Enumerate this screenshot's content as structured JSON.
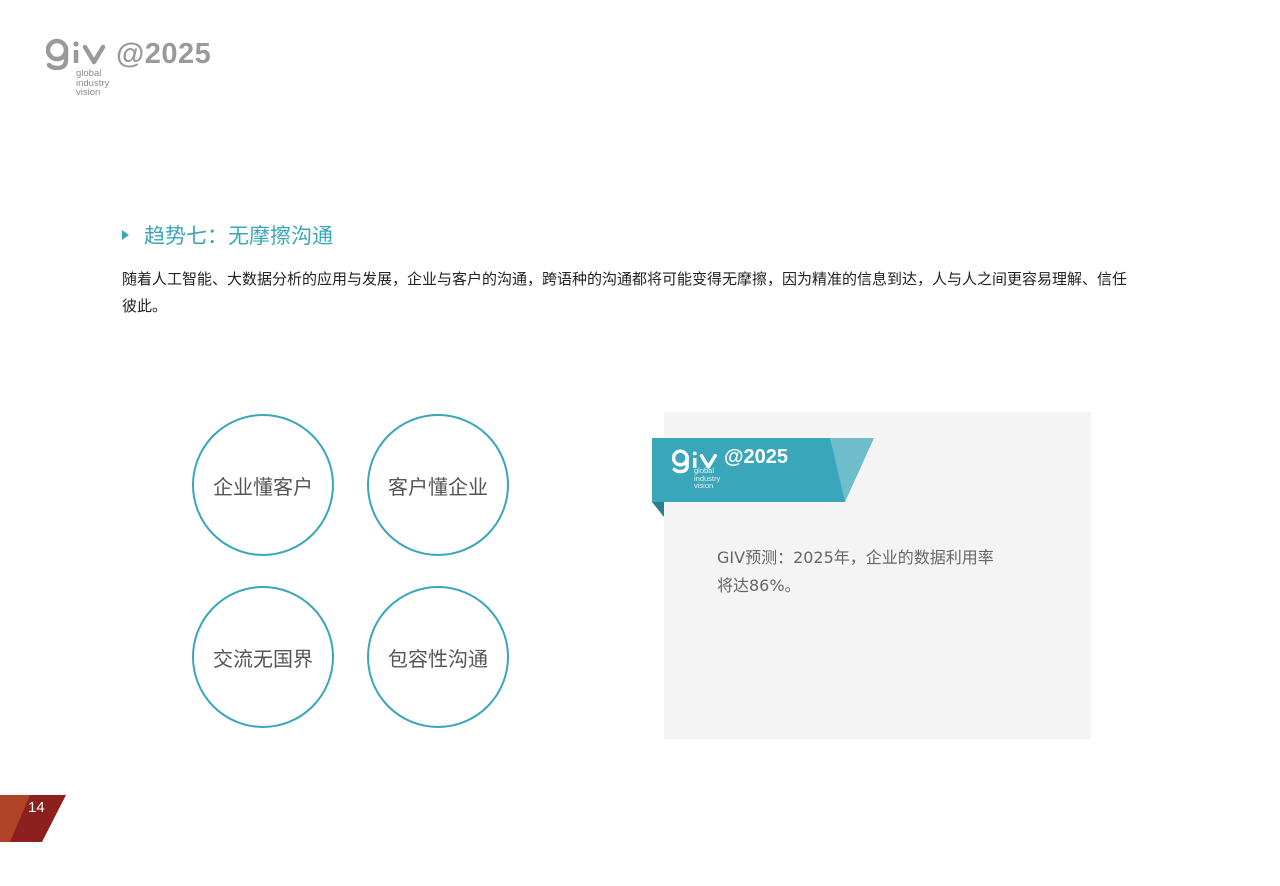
{
  "header": {
    "logo_year": "@2025",
    "logo_sub": [
      "global",
      "industry",
      "vision"
    ]
  },
  "trend": {
    "title": "趋势七：无摩擦沟通",
    "body": "随着人工智能、大数据分析的应用与发展，企业与客户的沟通，跨语种的沟通都将可能变得无摩擦，因为精准的信息到达，人与人之间更容易理解、信任彼此。"
  },
  "circles": [
    "企业懂客户",
    "客户懂企业",
    "交流无国界",
    "包容性沟通"
  ],
  "card": {
    "logo_year": "@2025",
    "logo_sub": [
      "global",
      "industry",
      "vision"
    ],
    "forecast_line1": "GIV预测：2025年，企业的数据利用率",
    "forecast_line2": "将达86%。"
  },
  "footer": {
    "page_number": "14"
  },
  "colors": {
    "accent": "#3aa6b9",
    "accent_light": "#6fbccb",
    "page_tab_dark": "#8e1f1f",
    "page_tab_light": "#b44a2a",
    "logo_gray": "#9a9a9a"
  }
}
